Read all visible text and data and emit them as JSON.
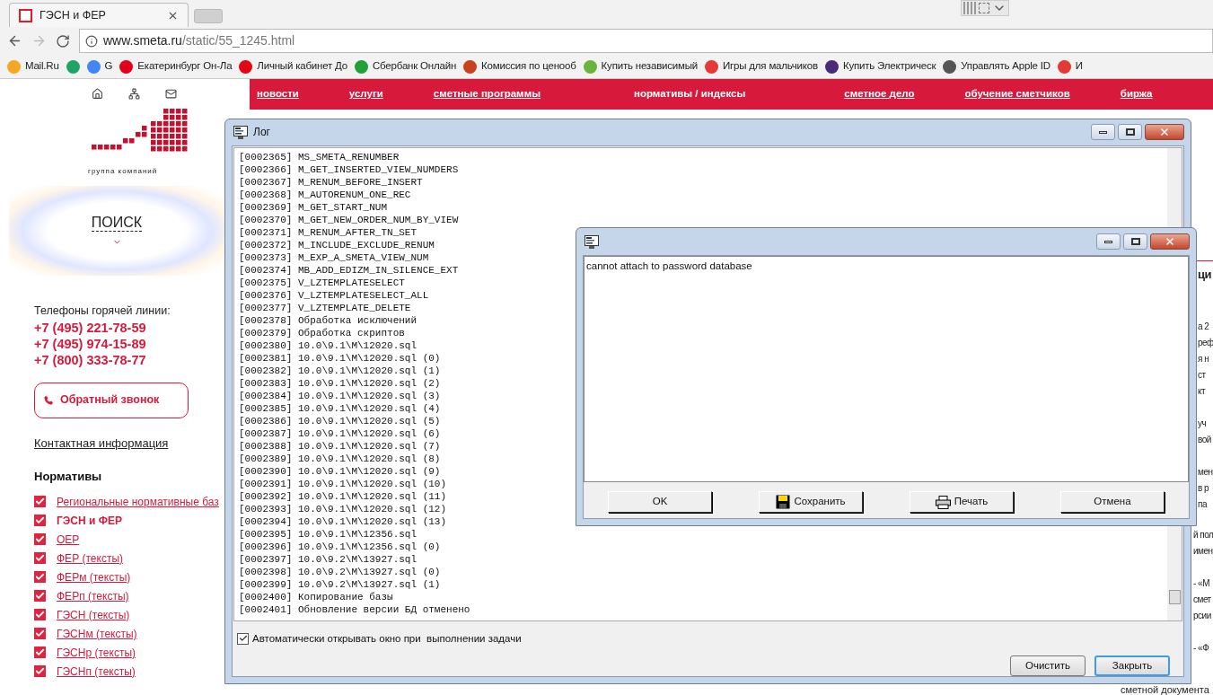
{
  "browser": {
    "tab_title": "ГЭСН и ФЕР",
    "address": {
      "domain": "www.smeta.ru",
      "path": "/static/55_1245.html"
    },
    "bookmarks": [
      {
        "label": "Mail.Ru",
        "color": "#f5a623"
      },
      {
        "color": "#1fa463"
      },
      {
        "label": "G",
        "color": "#4285f4"
      },
      {
        "label": "Екатеринбург Он-Ла",
        "color": "#e2001a"
      },
      {
        "label": "Личный кабинет До",
        "color": "#e30613"
      },
      {
        "label": "Сбербанк Онлайн",
        "color": "#21a038"
      },
      {
        "label": "Комиссия по ценооб",
        "color": "#c8421b"
      },
      {
        "label": "Купить независимый",
        "color": "#6cb33e"
      },
      {
        "label": "Игры для мальчиков",
        "color": "#e53935"
      },
      {
        "label": "Купить Электрическ",
        "color": "#4a2a7a"
      },
      {
        "label": "Управлять Apple ID",
        "color": "#555555"
      },
      {
        "label": "И",
        "color": "#e53935"
      }
    ]
  },
  "site": {
    "nav": [
      {
        "label": "новости",
        "selected": false
      },
      {
        "label": "услуги",
        "selected": false
      },
      {
        "label": "сметные программы",
        "selected": false
      },
      {
        "label": "нормативы / индексы",
        "selected": true
      },
      {
        "label": "сметное дело",
        "selected": false
      },
      {
        "label": "обучение сметчиков",
        "selected": false
      },
      {
        "label": "биржа",
        "selected": false
      }
    ],
    "group_caption": "группа компаний",
    "search": "ПОИСК",
    "hotline_label": "Телефоны горячей линии:",
    "phones": [
      "+7 (495) 221-78-59",
      "+7 (495) 974-15-89",
      "+7 (800) 333-78-77"
    ],
    "callback_button": "Обратный звонок",
    "contact_link": "Контактная информация",
    "section_title": "Нормативы",
    "normative_links": [
      {
        "label": "Региональные нормативные баз",
        "checked": true,
        "selected": false
      },
      {
        "label": "ГЭСН и ФЕР",
        "checked": true,
        "selected": true
      },
      {
        "label": "ОЕР",
        "checked": true,
        "selected": false
      },
      {
        "label": "ФЕР (тексты)",
        "checked": true,
        "selected": false
      },
      {
        "label": "ФЕРм (тексты)",
        "checked": true,
        "selected": false
      },
      {
        "label": "ФЕРп (тексты)",
        "checked": true,
        "selected": false
      },
      {
        "label": "ГЭСН (тексты)",
        "checked": true,
        "selected": false
      },
      {
        "label": "ГЭСНм (тексты)",
        "checked": true,
        "selected": false
      },
      {
        "label": "ГЭСНр (тексты)",
        "checked": true,
        "selected": false
      },
      {
        "label": "ГЭСНп (тексты)",
        "checked": true,
        "selected": false
      }
    ],
    "right_fragments": [
      "ци",
      "а 2",
      "реф",
      "я н",
      "ст",
      "кт",
      "уч",
      "вой",
      "мен",
      "в р",
      "па",
      "й пол",
      "имен",
      "- «М",
      "смет",
      "рсии",
      "- «Ф"
    ],
    "bottom_fragment": "сметной документа"
  },
  "log_window": {
    "title": "Лог",
    "lines": [
      "[0002365] MS_SMETA_RENUMBER",
      "[0002366] M_GET_INSERTED_VIEW_NUMDERS",
      "[0002367] M_RENUM_BEFORE_INSERT",
      "[0002368] M_AUTORENUM_ONE_REC",
      "[0002369] M_GET_START_NUM",
      "[0002370] M_GET_NEW_ORDER_NUM_BY_VIEW",
      "[0002371] M_RENUM_AFTER_TN_SET",
      "[0002372] M_INCLUDE_EXCLUDE_RENUM",
      "[0002373] M_EXP_A_SMETA_VIEW_NUM",
      "[0002374] MB_ADD_EDIZM_IN_SILENCE_EXT",
      "[0002375] V_LZTEMPLATESELECT",
      "[0002376] V_LZTEMPLATESELECT_ALL",
      "[0002377] V_LZTEMPLATE_DELETE",
      "[0002378] Обработка исключений",
      "[0002379] Обработка скриптов",
      "[0002380] 10.0\\9.1\\M\\12020.sql",
      "[0002381] 10.0\\9.1\\M\\12020.sql (0)",
      "[0002382] 10.0\\9.1\\M\\12020.sql (1)",
      "[0002383] 10.0\\9.1\\M\\12020.sql (2)",
      "[0002384] 10.0\\9.1\\M\\12020.sql (3)",
      "[0002385] 10.0\\9.1\\M\\12020.sql (4)",
      "[0002386] 10.0\\9.1\\M\\12020.sql (5)",
      "[0002387] 10.0\\9.1\\M\\12020.sql (6)",
      "[0002388] 10.0\\9.1\\M\\12020.sql (7)",
      "[0002389] 10.0\\9.1\\M\\12020.sql (8)",
      "[0002390] 10.0\\9.1\\M\\12020.sql (9)",
      "[0002391] 10.0\\9.1\\M\\12020.sql (10)",
      "[0002392] 10.0\\9.1\\M\\12020.sql (11)",
      "[0002393] 10.0\\9.1\\M\\12020.sql (12)",
      "[0002394] 10.0\\9.1\\M\\12020.sql (13)",
      "[0002395] 10.0\\9.1\\M\\12356.sql",
      "[0002396] 10.0\\9.1\\M\\12356.sql (0)",
      "[0002397] 10.0\\9.2\\M\\13927.sql",
      "[0002398] 10.0\\9.2\\M\\13927.sql (0)",
      "[0002399] 10.0\\9.2\\M\\13927.sql (1)",
      "[0002400] Копирование базы",
      "[0002401] Обновление версии БД отменено"
    ],
    "auto_open": {
      "label": "Автоматически открывать окно при  выполнении задачи",
      "checked": true
    },
    "buttons": [
      {
        "label": "Очистить",
        "selected": false
      },
      {
        "label": "Закрыть",
        "selected": true
      }
    ]
  },
  "dialog": {
    "message": "cannot attach to password database",
    "buttons": [
      {
        "label": "OK",
        "kind": "plain"
      },
      {
        "label": "Сохранить",
        "kind": "save"
      },
      {
        "label": "Печать",
        "kind": "print"
      },
      {
        "label": "Отмена",
        "kind": "plain"
      }
    ]
  }
}
